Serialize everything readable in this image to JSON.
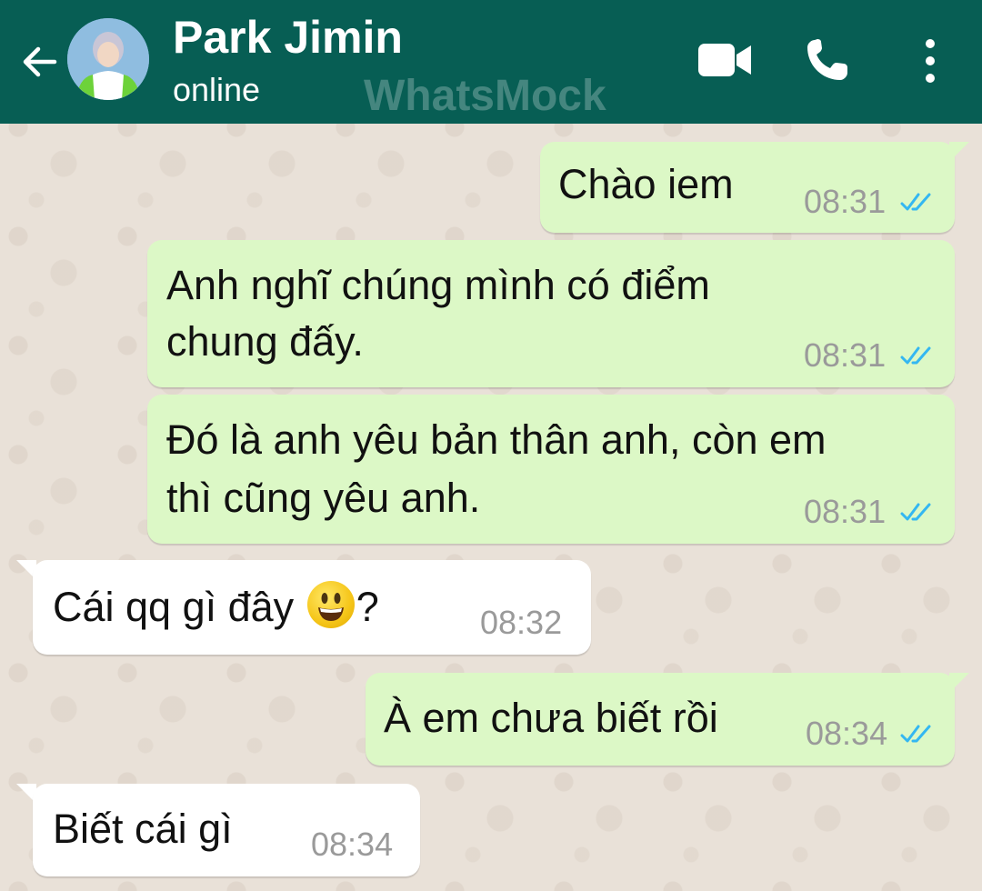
{
  "header": {
    "contact_name": "Park Jimin",
    "status": "online",
    "watermark": "WhatsMock"
  },
  "icons": {
    "back": "arrow-left-icon",
    "video": "video-call-icon",
    "phone": "phone-icon",
    "menu": "more-vertical-icon",
    "read_receipt": "double-check-icon",
    "emoji": "smiley-emoji-icon"
  },
  "colors": {
    "header_bg": "#075e54",
    "outgoing_bubble": "#dcf8c6",
    "incoming_bubble": "#ffffff",
    "read_tick": "#34b7f1"
  },
  "messages": [
    {
      "direction": "out",
      "line1": "Chào iem",
      "line2": "",
      "time": "08:31",
      "read": true
    },
    {
      "direction": "out",
      "line1": "Anh nghĩ chúng mình có điểm",
      "line2": "chung đấy.",
      "time": "08:31",
      "read": true
    },
    {
      "direction": "out",
      "line1": "Đó là anh yêu bản thân anh, còn em",
      "line2": "thì cũng yêu anh.",
      "time": "08:31",
      "read": true
    },
    {
      "direction": "in",
      "text_before_emoji": "Cái qq gì đây",
      "text_after_emoji": "?",
      "time": "08:32"
    },
    {
      "direction": "out",
      "line1": "À em chưa biết rồi",
      "line2": "",
      "time": "08:34",
      "read": true
    },
    {
      "direction": "in",
      "line1": "Biết cái gì",
      "line2": "",
      "time": "08:34"
    }
  ]
}
